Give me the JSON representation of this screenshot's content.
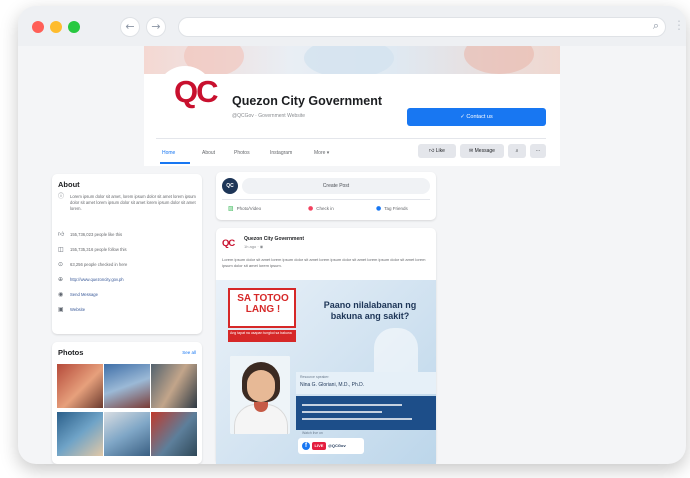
{
  "window": {
    "traffic_colors": [
      "#ff5f57",
      "#febc2e",
      "#28c840"
    ],
    "back_icon": "arrow-left-icon",
    "forward_icon": "arrow-right-icon",
    "address_value": "",
    "search_icon": "search-icon"
  },
  "page": {
    "logo": "QC",
    "name": "Quezon City Government",
    "subtitle": "@QCGov · Government Website",
    "contact_button": "✓ Contact us",
    "tabs": [
      {
        "label": "Home",
        "active": true
      },
      {
        "label": "About",
        "active": false
      },
      {
        "label": "Photos",
        "active": false
      },
      {
        "label": "Instagram",
        "active": false
      },
      {
        "label": "More ▾",
        "active": false
      }
    ],
    "actions": {
      "like": "Like",
      "message": "Message",
      "search_icon": "search-icon",
      "more": "···"
    }
  },
  "about": {
    "title": "About",
    "description": "Lorem ipsum dolor sit amet, lorem ipsum dolor sit amet lorem ipsum dolor sit amet lorem ipsum dolor sit amet lorem ipsum dolor sit amet lorem.",
    "items": [
      {
        "icon": "like-icon",
        "text": "155,736,023 people like this"
      },
      {
        "icon": "follow-icon",
        "text": "155,735,316 people follow this"
      },
      {
        "icon": "checkin-icon",
        "text": "63,256 people checked in here"
      },
      {
        "icon": "website-icon",
        "text": "http://www.quezoncity.gov.ph"
      },
      {
        "icon": "messenger-icon",
        "text": "Send Message"
      },
      {
        "icon": "category-icon",
        "text": "Website"
      }
    ]
  },
  "photos": {
    "title": "Photos",
    "see_all": "See all"
  },
  "create_post": {
    "avatar": "QC",
    "placeholder": "Create Post",
    "options": [
      "Photo/Video",
      "Check in",
      "Tag Friends"
    ]
  },
  "post": {
    "logo": "QC",
    "author": "Quezon City Government",
    "time": "1h ago · ◉",
    "text": "Lorem ipsum dolor sit amet lorem ipsum dolor sit amet lorem ipsum dolor sit amet lorem ipsum dolor sit amet lorem ipsum dolor sit amet lorem ipsum.",
    "poster": {
      "badge": "SA TOTOO LANG !",
      "tag": "Ang tapat na usapan tungkol sa bakuna",
      "question": "Paano nilalabanan ng bakuna ang sakit?",
      "guest_label": "Resource speaker:",
      "guest_name": "Nina G. Gloriani, M.D., Ph.D.",
      "fb_label": "Watch live on",
      "live": "LIVE",
      "fb_handle": "@QCGov"
    }
  }
}
